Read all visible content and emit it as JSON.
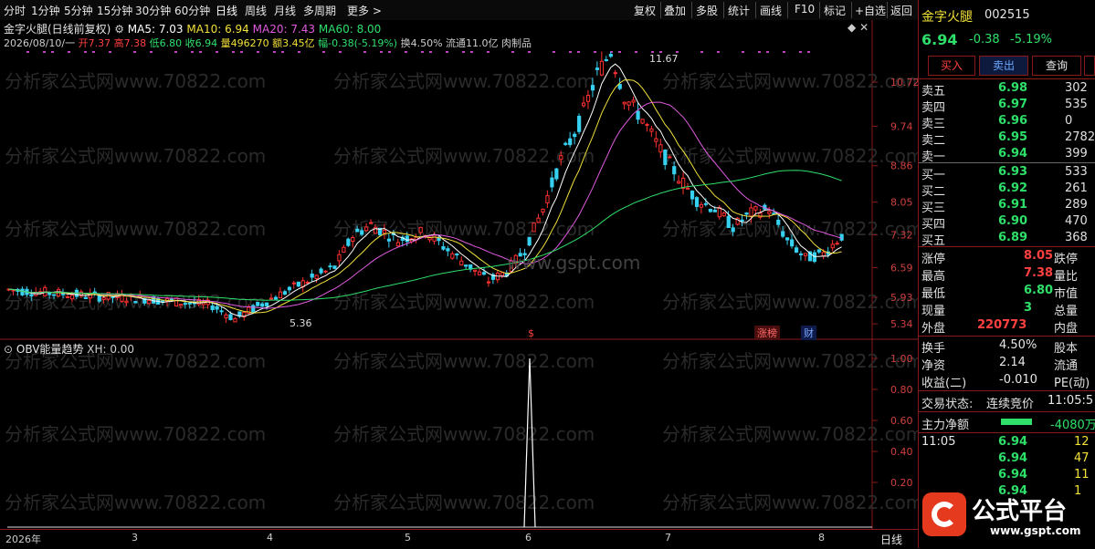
{
  "toolbar": {
    "left": [
      "分时",
      "1分钟",
      "5分钟",
      "15分钟",
      "30分钟",
      "60分钟",
      "日线",
      "周线",
      "月线",
      "多周期",
      "更多 >"
    ],
    "right": [
      "复权",
      "叠加",
      "多股",
      "统计",
      "画线",
      "F10",
      "标记",
      "+自选",
      "返回"
    ]
  },
  "chart": {
    "title": "金字火腿(日线前复权)",
    "ma_labels": [
      "MA5: 7.03",
      "MA10: 6.94",
      "MA20: 7.43",
      "MA60: 8.00"
    ],
    "info_date": "2026/08/10/一",
    "info_open": "开7.37",
    "info_high": "高7.38",
    "info_low": "低6.80",
    "info_close": "收6.94",
    "info_vol": "量496270",
    "info_amt": "额3.45亿",
    "info_chg": "幅-0.38(-5.19%)",
    "info_turn": "换4.50%",
    "info_float": "流通11.0亿",
    "info_sector": "肉制品",
    "price_axis": [
      "10.72",
      "9.74",
      "8.86",
      "8.05",
      "7.32",
      "6.59",
      "5.93",
      "5.34"
    ],
    "high_label": "11.67",
    "low_label": "5.36",
    "watermark_site": "www.gspt.com",
    "watermark_text": "分析家公式网www.70822.com",
    "tag_zhangbang": "涨榜",
    "tag_cai": "财",
    "tag_s": "$"
  },
  "indicator": {
    "title": "OBV能量趋势",
    "xh": "XH: 0.00",
    "axis": [
      "1.00",
      "0.80",
      "0.60",
      "0.40",
      "0.20"
    ]
  },
  "xaxis": {
    "labels": [
      "2026年",
      "3",
      "4",
      "5",
      "6",
      "7",
      "8"
    ],
    "period": "日线"
  },
  "panel": {
    "name": "金字火腿",
    "code": "002515",
    "price": "6.94",
    "change": "-0.38",
    "pct": "-5.19%",
    "buy_btn": "买入",
    "sell_btn": "卖出",
    "query_btn": "查询",
    "asks": [
      {
        "label": "卖五",
        "price": "6.98",
        "vol": "302"
      },
      {
        "label": "卖四",
        "price": "6.97",
        "vol": "535"
      },
      {
        "label": "卖三",
        "price": "6.96",
        "vol": "0"
      },
      {
        "label": "卖二",
        "price": "6.95",
        "vol": "2782"
      },
      {
        "label": "卖一",
        "price": "6.94",
        "vol": "399"
      }
    ],
    "bids": [
      {
        "label": "买一",
        "price": "6.93",
        "vol": "533"
      },
      {
        "label": "买二",
        "price": "6.92",
        "vol": "261"
      },
      {
        "label": "买三",
        "price": "6.91",
        "vol": "289"
      },
      {
        "label": "买四",
        "price": "6.90",
        "vol": "470"
      },
      {
        "label": "买五",
        "price": "6.89",
        "vol": "368"
      }
    ],
    "stats": [
      {
        "l1": "涨停",
        "v1": "8.05",
        "l2": "跌停"
      },
      {
        "l1": "最高",
        "v1": "7.38",
        "l2": "量比"
      },
      {
        "l1": "最低",
        "v1": "6.80",
        "l2": "市值"
      },
      {
        "l1": "现量",
        "v1": "3",
        "l2": "总量"
      },
      {
        "l1": "外盘",
        "v1": "220773",
        "l2": "内盘"
      }
    ],
    "stats2": [
      {
        "l1": "换手",
        "v1": "4.50%",
        "l2": "股本"
      },
      {
        "l1": "净资",
        "v1": "2.14",
        "l2": "流通"
      },
      {
        "l1": "收益(二)",
        "v1": "-0.010",
        "l2": "PE(动)"
      }
    ],
    "status_label": "交易状态:",
    "status_value": "连续竞价",
    "status_time": "11:05:5",
    "netflow_label": "主力净额",
    "netflow_value": "-4080万",
    "ticks": [
      {
        "time": "11:05",
        "price": "6.94",
        "vol": "12"
      },
      {
        "time": "",
        "price": "6.94",
        "vol": "47"
      },
      {
        "time": "",
        "price": "6.94",
        "vol": "11"
      },
      {
        "time": "",
        "price": "6.94",
        "vol": "1"
      }
    ],
    "logo_text": "公式平台",
    "logo_url": "www.gspt.com"
  },
  "chart_data": {
    "type": "candlestick",
    "ylim": [
      5.2,
      11.9
    ],
    "ma_series": [
      "MA5",
      "MA10",
      "MA20",
      "MA60"
    ]
  }
}
